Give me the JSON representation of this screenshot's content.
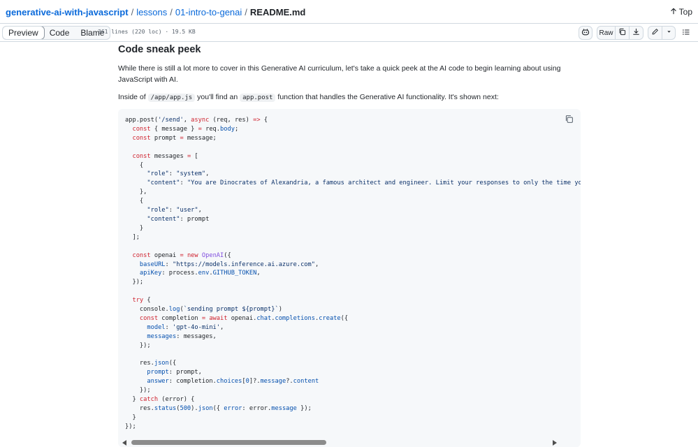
{
  "breadcrumb": {
    "repo": "generative-ai-with-javascript",
    "seg1": "lessons",
    "seg2": "01-intro-to-genai",
    "file": "README.md",
    "sep": "/"
  },
  "top_link": "Top",
  "toolbar": {
    "tabs": [
      "Preview",
      "Code",
      "Blame"
    ],
    "active_tab": "Preview",
    "file_info": "361 lines (220 loc) · 19.5 KB",
    "raw_label": "Raw"
  },
  "content": {
    "heading": "Code sneak peek",
    "para1": "While there is still a lot more to cover in this Generative AI curriculum, let's take a quick peek at the AI code to begin learning about using JavaScript with AI.",
    "para2_pre": "Inside of ",
    "para2_code1": "/app/app.js",
    "para2_mid": " you'll find an ",
    "para2_code2": "app.post",
    "para2_post": " function that handles the Generative AI functionality. It's shown next:"
  },
  "code_lines": [
    "app.post('/send', async (req, res) => {",
    "  const { message } = req.body;",
    "  const prompt = message;",
    "",
    "  const messages = [",
    "    {",
    "      \"role\": \"system\",",
    "      \"content\": \"You are Dinocrates of Alexandria, a famous architect and engineer. Limit your responses to only the time you l",
    "    },",
    "    {",
    "      \"role\": \"user\",",
    "      \"content\": prompt",
    "    }",
    "  ];",
    "",
    "  const openai = new OpenAI({",
    "    baseURL: \"https://models.inference.ai.azure.com\",",
    "    apiKey: process.env.GITHUB_TOKEN,",
    "  });",
    "",
    "  try {",
    "    console.log(`sending prompt ${prompt}`)",
    "    const completion = await openai.chat.completions.create({",
    "      model: 'gpt-4o-mini',",
    "      messages: messages,",
    "    });",
    "",
    "    res.json({",
    "      prompt: prompt,",
    "      answer: completion.choices[0]?.message?.content",
    "    });",
    "  } catch (error) {",
    "    res.status(500).json({ error: error.message });",
    "  }",
    "});"
  ],
  "colors": {
    "keyword": "#cf222e",
    "string": "#0a3069",
    "property": "#0550ae",
    "function": "#8250df",
    "link": "#0969da"
  },
  "icons": {
    "top": "arrow-up-icon",
    "copilot": "copilot-icon",
    "copy": "copy-icon",
    "download": "download-icon",
    "edit": "pencil-icon",
    "more": "triangle-down-icon",
    "outline": "list-unordered-icon",
    "copy_code": "copy-icon"
  }
}
